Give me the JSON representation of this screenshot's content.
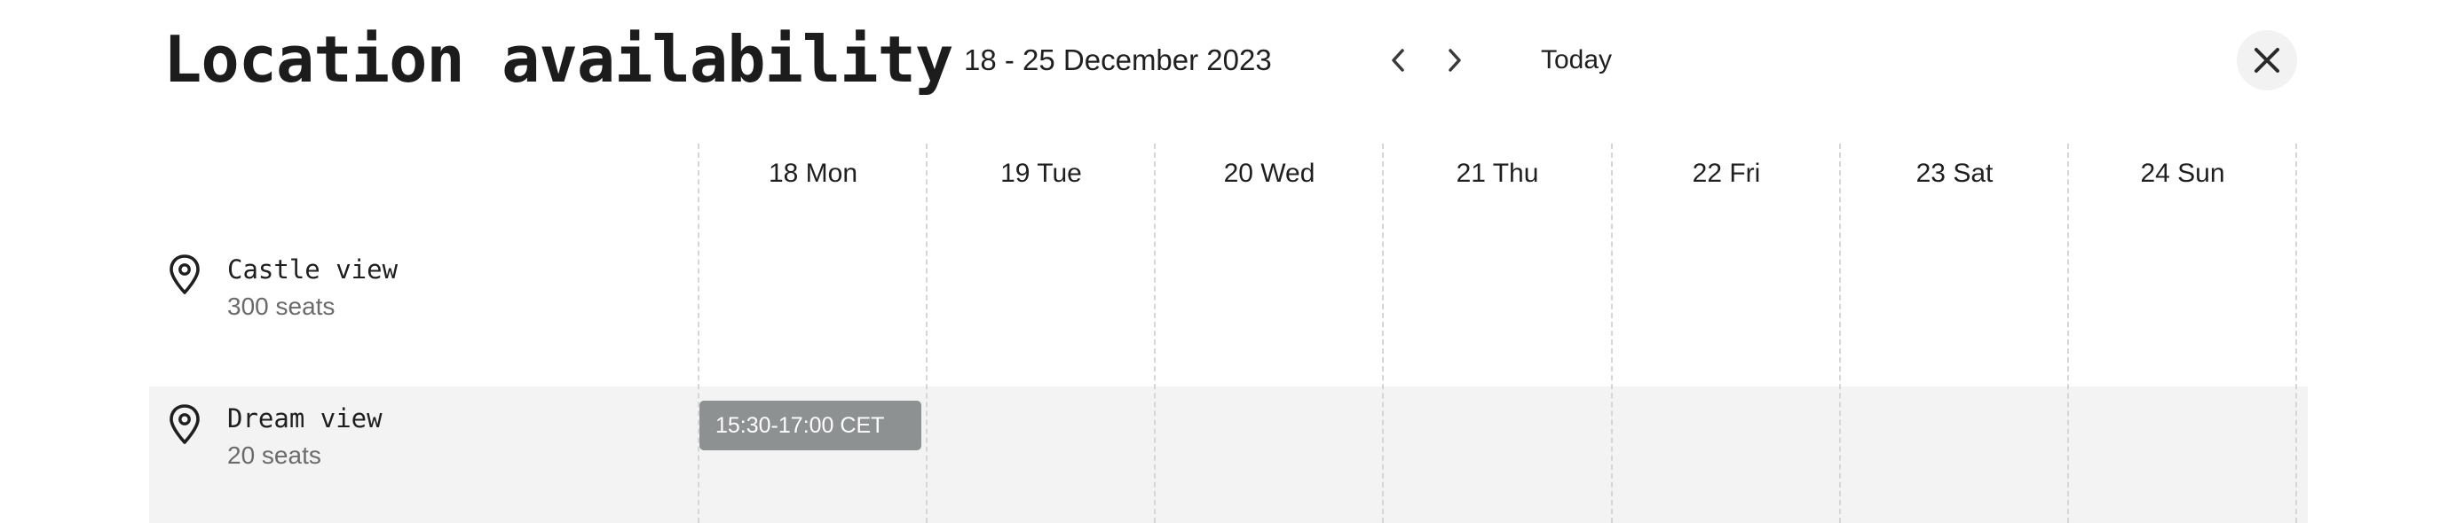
{
  "header": {
    "title": "Location availability",
    "date_range": "18 - 25 December 2023",
    "prev_icon": "chevron-left-icon",
    "next_icon": "chevron-right-icon",
    "today_label": "Today",
    "close_icon": "close-icon"
  },
  "days": [
    "18 Mon",
    "19 Tue",
    "20 Wed",
    "21 Thu",
    "22 Fri",
    "23 Sat",
    "24 Sun"
  ],
  "locations": [
    {
      "name": "Castle view",
      "seats": "300 seats",
      "icon": "location-pin-icon"
    },
    {
      "name": "Dream view",
      "seats": "20 seats",
      "icon": "location-pin-icon"
    }
  ],
  "bookings": [
    {
      "location": "Dream view",
      "day": "18 Mon",
      "label": "15:30-17:00 CET"
    }
  ],
  "colors": {
    "highlight_row": "#f2f3f2",
    "booking_bg": "#8e9191",
    "close_btn_bg": "#f1f2f1",
    "grid_line": "#d6d6d6"
  }
}
